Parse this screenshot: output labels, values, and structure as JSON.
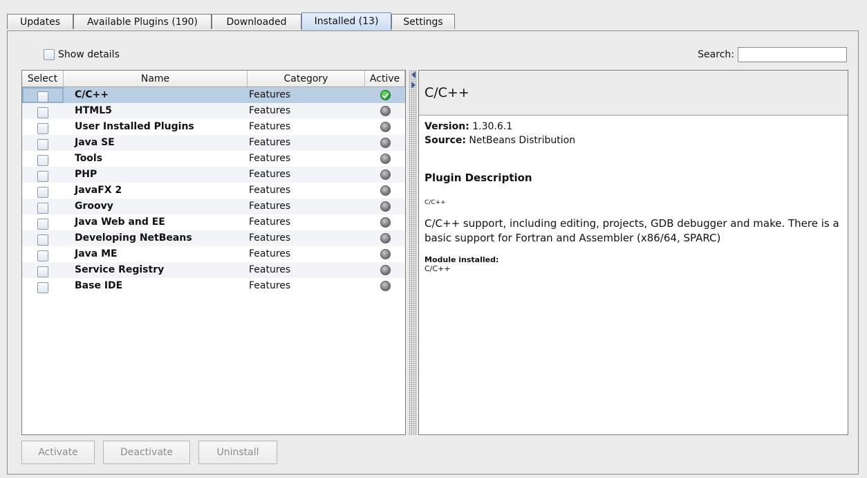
{
  "tabs": [
    {
      "label": "Updates",
      "active": false
    },
    {
      "label": "Available Plugins (190)",
      "active": false
    },
    {
      "label": "Downloaded",
      "active": false
    },
    {
      "label": "Installed (13)",
      "active": true
    },
    {
      "label": "Settings",
      "active": false
    }
  ],
  "toolbar": {
    "show_details_label": "Show details",
    "show_details_mnemonic": "w",
    "show_details_checked": false,
    "search_label": "Search:",
    "search_value": ""
  },
  "table": {
    "headers": [
      "Select",
      "Name",
      "Category",
      "Active"
    ],
    "rows": [
      {
        "name": "C/C++",
        "category": "Features",
        "active": true,
        "selected": true
      },
      {
        "name": "HTML5",
        "category": "Features",
        "active": false,
        "selected": false
      },
      {
        "name": "User Installed Plugins",
        "category": "Features",
        "active": false,
        "selected": false
      },
      {
        "name": "Java SE",
        "category": "Features",
        "active": false,
        "selected": false
      },
      {
        "name": "Tools",
        "category": "Features",
        "active": false,
        "selected": false
      },
      {
        "name": "PHP",
        "category": "Features",
        "active": false,
        "selected": false
      },
      {
        "name": "JavaFX 2",
        "category": "Features",
        "active": false,
        "selected": false
      },
      {
        "name": "Groovy",
        "category": "Features",
        "active": false,
        "selected": false
      },
      {
        "name": "Java Web and EE",
        "category": "Features",
        "active": false,
        "selected": false
      },
      {
        "name": "Developing NetBeans",
        "category": "Features",
        "active": false,
        "selected": false
      },
      {
        "name": "Java ME",
        "category": "Features",
        "active": false,
        "selected": false
      },
      {
        "name": "Service Registry",
        "category": "Features",
        "active": false,
        "selected": false
      },
      {
        "name": "Base IDE",
        "category": "Features",
        "active": false,
        "selected": false
      }
    ]
  },
  "details": {
    "title": "C/C++",
    "version_label": "Version:",
    "version_value": "1.30.6.1",
    "source_label": "Source:",
    "source_value": "NetBeans Distribution",
    "description_title": "Plugin Description",
    "small_name": "C/C++",
    "description": "C/C++ support, including editing, projects, GDB debugger and make. There is a basic support for Fortran and Assembler (x86/64, SPARC)",
    "module_installed_label": "Module installed:",
    "module_installed_value": "C/C++"
  },
  "buttons": {
    "activate": "Activate",
    "deactivate": "Deactivate",
    "uninstall": "Uninstall"
  },
  "colors": {
    "selection": "#b9cde3",
    "active_tab": "#c9dcf3",
    "active_dot": "#1f9d2b",
    "inactive_dot": "#6d6d6d"
  }
}
